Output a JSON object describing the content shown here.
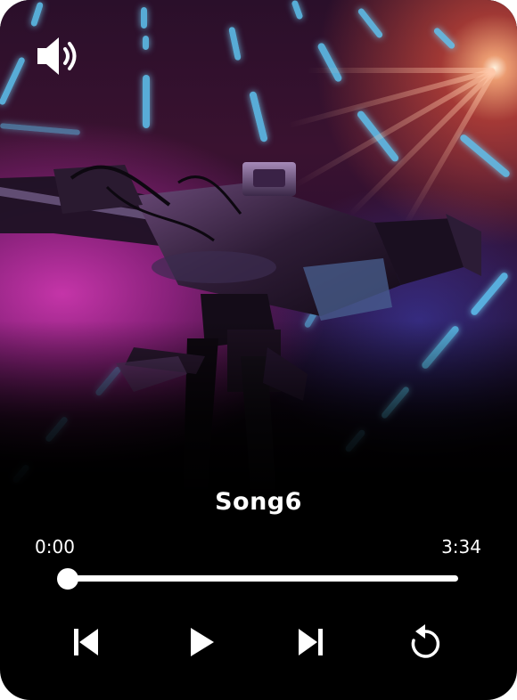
{
  "track": {
    "title": "Song6",
    "current_time": "0:00",
    "duration": "3:34",
    "progress": 0
  },
  "icons": {
    "volume": "volume-icon",
    "previous": "skip-previous-icon",
    "play": "play-icon",
    "next": "skip-next-icon",
    "repeat": "replay-icon"
  },
  "colors": {
    "background": "#000000",
    "foreground": "#ffffff"
  }
}
